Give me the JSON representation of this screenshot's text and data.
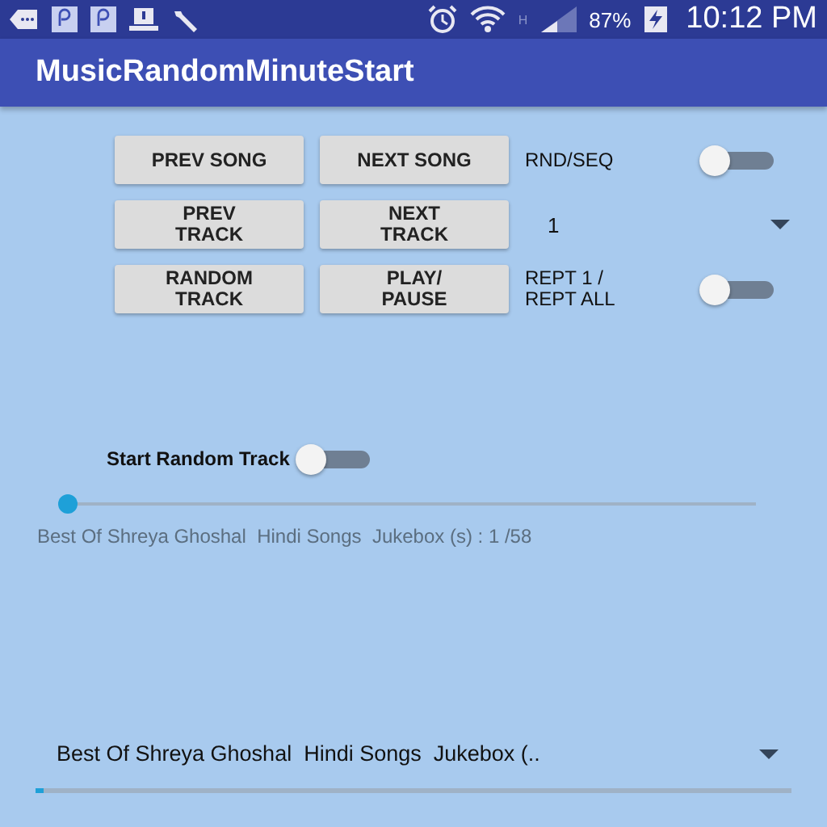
{
  "status_bar": {
    "network": "H",
    "battery": "87%",
    "time": "10:12 PM"
  },
  "app_bar": {
    "title": "MusicRandomMinuteStart"
  },
  "control_rows": [
    {
      "buttons": [
        "PREV SONG",
        "NEXT SONG"
      ],
      "side": {
        "kind": "toggle",
        "label": "RND/SEQ",
        "on": false
      }
    },
    {
      "buttons": [
        "PREV\nTRACK",
        "NEXT\nTRACK"
      ],
      "side": {
        "kind": "dropdown",
        "value": "1"
      }
    },
    {
      "buttons": [
        "RANDOM\nTRACK",
        "PLAY/\nPAUSE"
      ],
      "side": {
        "kind": "toggle",
        "label": "REPT 1 /\nREPT ALL",
        "on": false
      }
    }
  ],
  "start_random": {
    "label": "Start Random Track",
    "on": false
  },
  "seek_bar": {
    "level": 0
  },
  "track_info": "Best Of Shreya Ghoshal  Hindi Songs  Jukebox (s) : 1 /58",
  "song_spinner": {
    "value": "Best Of Shreya Ghoshal  Hindi Songs  Jukebox (.."
  },
  "progress_bar": {
    "level": 0.01
  }
}
